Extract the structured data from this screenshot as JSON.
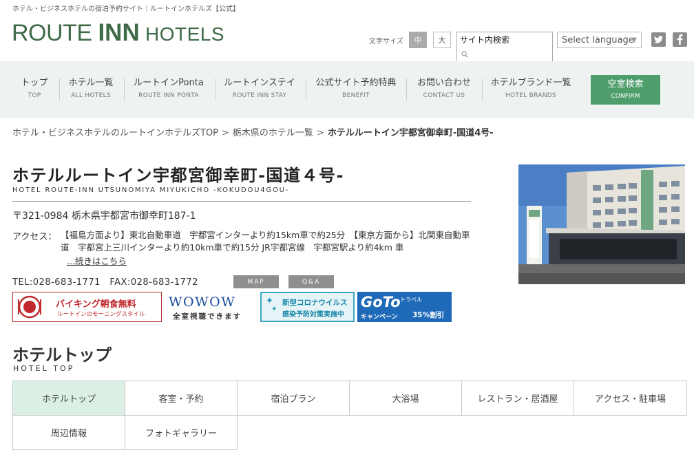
{
  "header": {
    "tagline": "ホテル・ビジネスホテルの宿泊予約サイト｜ルートインホテルズ【公式】",
    "logo": {
      "part1": "ROUTE ",
      "part2": "INN",
      "part3": " HOTELS"
    },
    "font_size_label": "文字サイズ",
    "font_size_mid": "中",
    "font_size_big": "大",
    "search_title": "サイト内検索",
    "search_value": "",
    "language_select": "Select language"
  },
  "nav": {
    "items": [
      {
        "jp": "トップ",
        "en": "TOP"
      },
      {
        "jp": "ホテル一覧",
        "en": "ALL HOTELS"
      },
      {
        "jp": "ルートインPonta",
        "en": "ROUTE INN PONTA"
      },
      {
        "jp": "ルートインステイ",
        "en": "ROUTE INN STAY"
      },
      {
        "jp": "公式サイト予約特典",
        "en": "BENEFIT"
      },
      {
        "jp": "お問い合わせ",
        "en": "CONTACT US"
      },
      {
        "jp": "ホテルブランド一覧",
        "en": "HOTEL BRANDS"
      }
    ],
    "cta": {
      "jp": "空室検索",
      "en": "CONFIRM"
    }
  },
  "breadcrumb": {
    "items": [
      "ホテル・ビジネスホテルのルートインホテルズTOP",
      "栃木県のホテル一覧"
    ],
    "current": "ホテルルートイン宇都宮御幸町-国道4号-",
    "separator": ">"
  },
  "hotel": {
    "name": "ホテルルートイン宇都宮御幸町-国道４号-",
    "name_en": "HOTEL ROUTE-INN UTSUNOMIYA MIYUKICHO -KOKUDOU4GOU-",
    "address": "〒321-0984 栃木県宇都宮市御幸町187-1",
    "access_label": "アクセス：",
    "access_text": "【福島方面より】東北自動車道　宇都宮インターより約15km車で約25分　【東京方面から】北関東自動車道　宇都宮上三川インターより約10km車で約15分 JR宇都宮線　宇都宮駅より約4km 車",
    "access_more": "...続きはこちら",
    "tel_fax": "TEL:028-683-1771　FAX:028-683-1772",
    "map_button": "MAP",
    "qa_button": "Q&A"
  },
  "banners": {
    "viking_title": "バイキング朝食無料",
    "viking_sub": "ルートインのモーニングスタイル",
    "wowow_title": "WOWOW",
    "wowow_sub": "全室視聴できます",
    "corona_title": "新型コロナウイルス",
    "corona_sub": "感染予防対策実施中",
    "goto_title": "GoTo",
    "goto_small": "トラベル",
    "goto_sub": "キャンペーン",
    "goto_discount": "35%割引"
  },
  "section": {
    "title": "ホテルトップ",
    "subtitle": "HOTEL TOP"
  },
  "tabs": [
    "ホテルトップ",
    "客室・予約",
    "宿泊プラン",
    "大浴場",
    "レストラン・居酒屋",
    "アクセス・駐車場",
    "周辺情報",
    "フォトギャラリー"
  ],
  "colors": {
    "brand_green": "#3f6a47",
    "cta_green": "#4e9d6b",
    "nav_bg": "#eef3f1",
    "active_tab": "#dbefe4"
  }
}
